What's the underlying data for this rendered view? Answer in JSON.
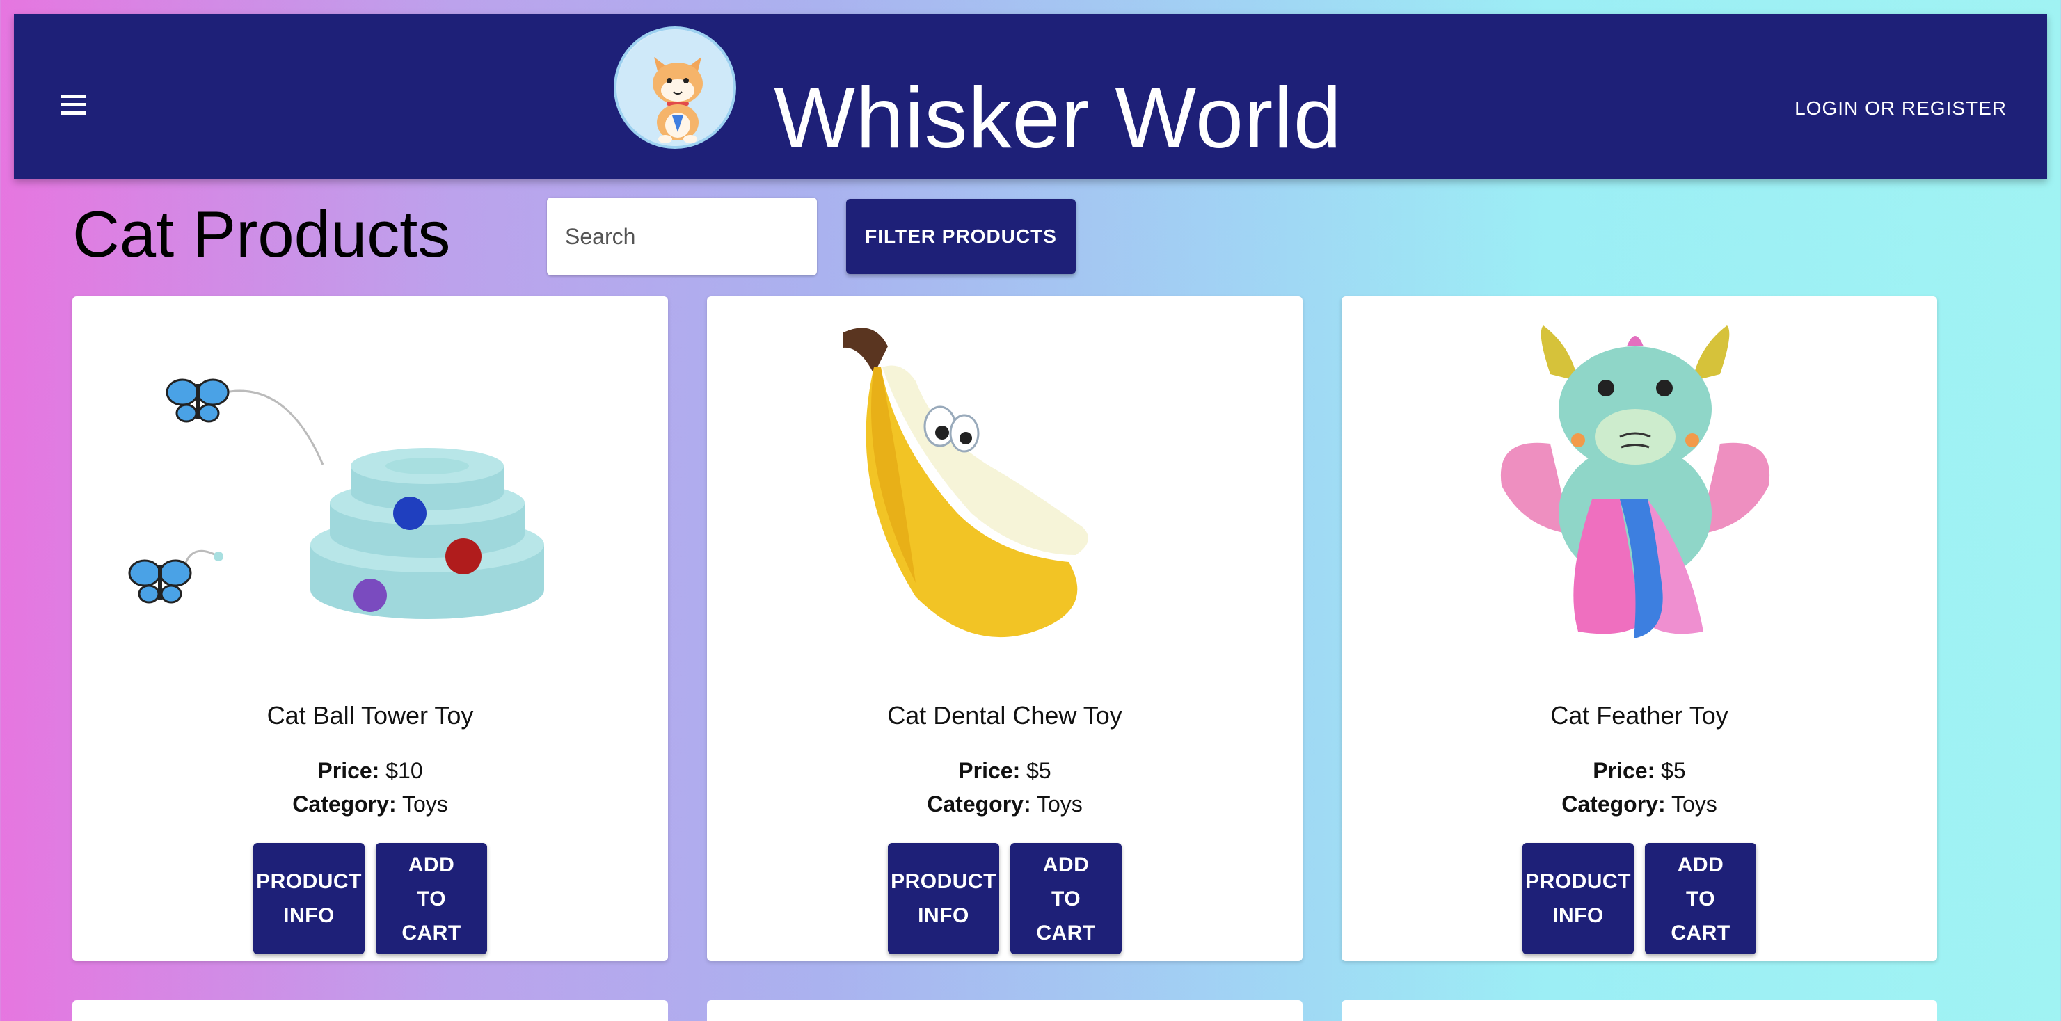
{
  "header": {
    "brand": "Whisker World",
    "login_label": "LOGIN OR REGISTER"
  },
  "page": {
    "title": "Cat Products",
    "search_placeholder": "Search",
    "filter_label": "FILTER PRODUCTS"
  },
  "labels": {
    "price": "Price:",
    "category": "Category:",
    "product_info": "PRODUCT INFO",
    "add_to_cart": "ADD TO CART"
  },
  "products": [
    {
      "name": "Cat Ball Tower Toy",
      "price": "$10",
      "category": "Toys",
      "image": "ball-tower-toy"
    },
    {
      "name": "Cat Dental Chew Toy",
      "price": "$5",
      "category": "Toys",
      "image": "banana-chew-toy"
    },
    {
      "name": "Cat Feather Toy",
      "price": "$5",
      "category": "Toys",
      "image": "dragon-feather-toy"
    }
  ],
  "colors": {
    "primary": "#1e2078",
    "card": "#ffffff"
  }
}
